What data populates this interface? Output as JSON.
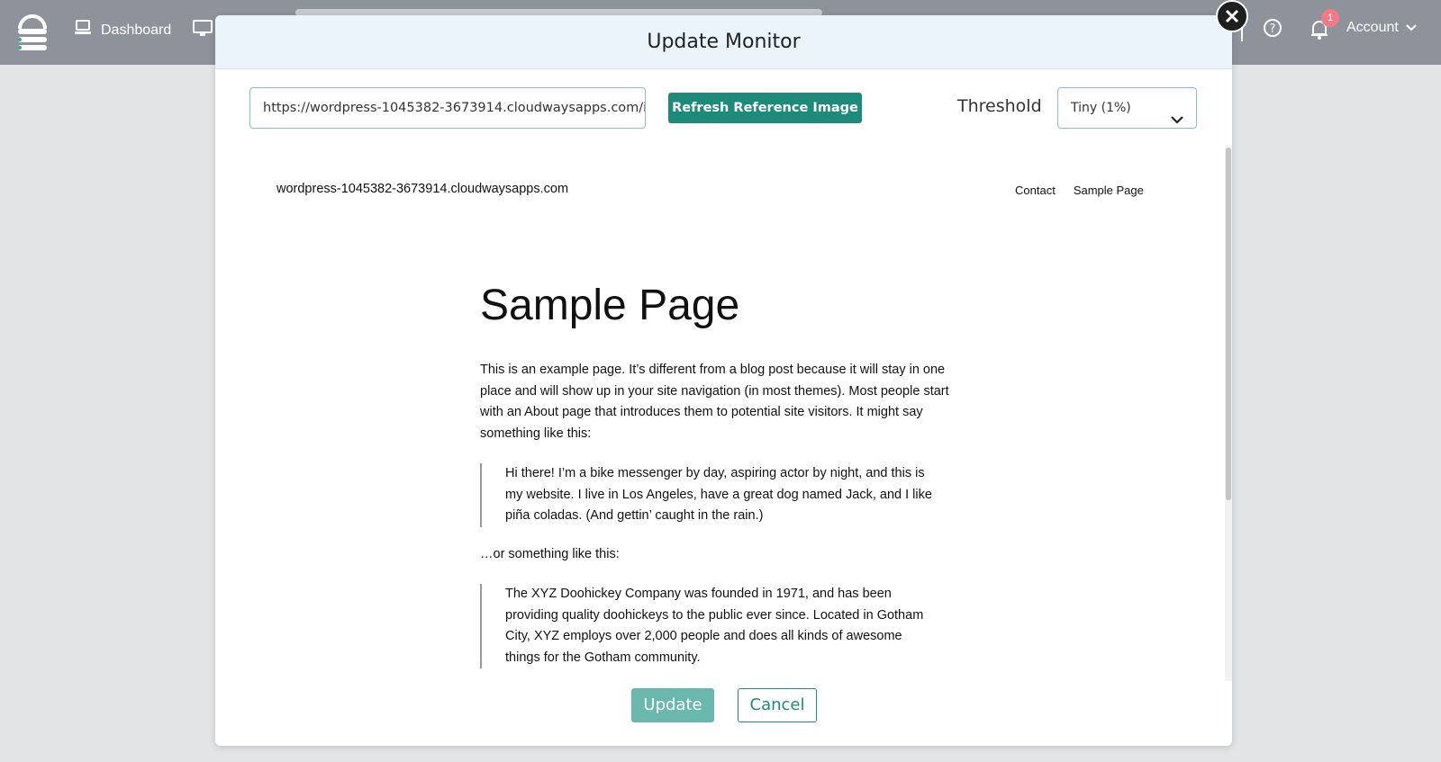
{
  "topbar": {
    "nav_dashboard": "Dashboard",
    "notifications_count": "1",
    "account_label": "Account"
  },
  "modal": {
    "title": "Update Monitor",
    "url_value": "https://wordpress-1045382-3673914.cloudwaysapps.com/i",
    "refresh_label": "Refresh Reference Image",
    "threshold_label": "Threshold",
    "threshold_value": "Tiny (1%)",
    "update_label": "Update",
    "cancel_label": "Cancel"
  },
  "preview": {
    "site_title": "wordpress-1045382-3673914.cloudwaysapps.com",
    "nav": [
      "Contact",
      "Sample Page"
    ],
    "page_title": "Sample Page",
    "intro": "This is an example page. It’s different from a blog post because it will stay in one place and will show up in your site navigation (in most themes). Most people start with an About page that introduces them to potential site visitors. It might say something like this:",
    "quote1": "Hi there! I’m a bike messenger by day, aspiring actor by night, and this is my website. I live in Los Angeles, have a great dog named Jack, and I like piña coladas. (And gettin’ caught in the rain.)",
    "middle": "…or something like this:",
    "quote2": "The XYZ Doohickey Company was founded in 1971, and has been providing quality doohickeys to the public ever since. Located in Gotham City, XYZ employs over 2,000 people and does all kinds of awesome things for the Gotham community."
  },
  "colors": {
    "topbar": "#8e939b",
    "accent": "#1e8a79",
    "accent_light": "#6ab8ad",
    "badge": "#f07a85"
  }
}
